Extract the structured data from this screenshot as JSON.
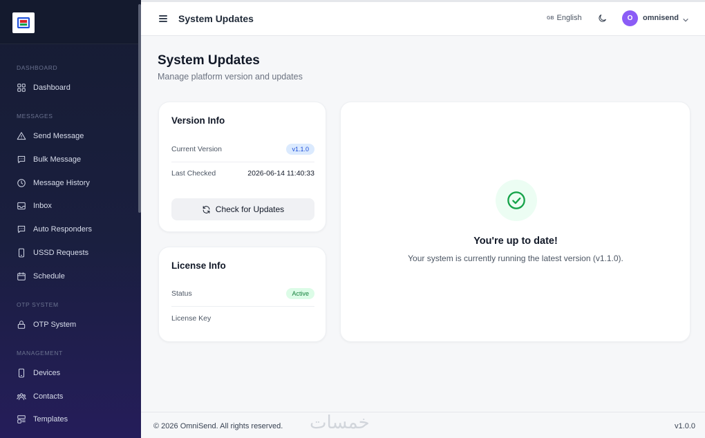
{
  "sidebar": {
    "sections": {
      "dashboard": "DASHBOARD",
      "messages": "MESSAGES",
      "otp": "OTP SYSTEM",
      "management": "MANAGEMENT"
    },
    "items": [
      {
        "label": "Dashboard",
        "icon": "grid-icon"
      },
      {
        "label": "Send Message",
        "icon": "send-icon"
      },
      {
        "label": "Bulk Message",
        "icon": "chat-icon"
      },
      {
        "label": "Message History",
        "icon": "clock-icon"
      },
      {
        "label": "Inbox",
        "icon": "inbox-icon"
      },
      {
        "label": "Auto Responders",
        "icon": "chat-icon"
      },
      {
        "label": "USSD Requests",
        "icon": "phone-icon"
      },
      {
        "label": "Schedule",
        "icon": "calendar-icon"
      },
      {
        "label": "OTP System",
        "icon": "lock-icon"
      },
      {
        "label": "Devices",
        "icon": "phone-icon"
      },
      {
        "label": "Contacts",
        "icon": "users-icon"
      },
      {
        "label": "Templates",
        "icon": "template-icon"
      }
    ]
  },
  "header": {
    "title": "System Updates",
    "language_flag": "GB",
    "language": "English",
    "user_initial": "O",
    "username": "omnisend"
  },
  "main": {
    "title": "System Updates",
    "subtitle": "Manage platform version and updates",
    "version_info": {
      "title": "Version Info",
      "current_version_label": "Current Version",
      "current_version": "v1.1.0",
      "last_checked_label": "Last Checked",
      "last_checked": "2026-06-14 11:40:33",
      "check_button": "Check for Updates"
    },
    "license_info": {
      "title": "License Info",
      "status_label": "Status",
      "status": "Active",
      "license_key_label": "License Key"
    },
    "status": {
      "title": "You're up to date!",
      "message": "Your system is currently running the latest version (v1.1.0)."
    }
  },
  "footer": {
    "copyright": "© 2026 OmniSend. All rights reserved.",
    "version": "v1.0.0",
    "watermark": "خمسات"
  },
  "colors": {
    "accent": "#8b5cf6",
    "success": "#16a34a",
    "sidebar_bg": "#1a1f3f"
  }
}
